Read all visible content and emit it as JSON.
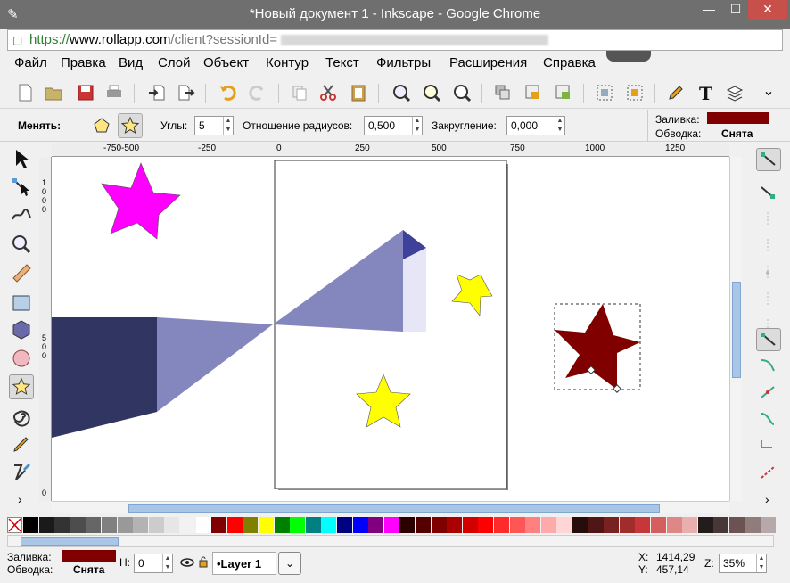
{
  "window": {
    "title": "*Новый документ 1 - Inkscape - Google Chrome",
    "controls": {
      "minimize": "—",
      "maximize": "☐",
      "close": "✕"
    }
  },
  "address": {
    "https": "https://",
    "host": "www.rollapp.com",
    "path": "/client?sessionId="
  },
  "menu": [
    "Файл",
    "Правка",
    "Вид",
    "Слой",
    "Объект",
    "Контур",
    "Текст",
    "Фильтры",
    "Расширения",
    "Справка"
  ],
  "toolbar": {
    "buttons": [
      "new-document",
      "open",
      "save",
      "print",
      "import",
      "export",
      "undo",
      "redo",
      "duplicate",
      "cut",
      "paste",
      "zoom-selection",
      "zoom-drawing",
      "zoom-page",
      "group",
      "lock",
      "unlock",
      "align",
      "node-editor",
      "fill-stroke",
      "text",
      "layers",
      "more"
    ],
    "more_label": "⌄"
  },
  "controls": {
    "change_label": "Менять:",
    "corners_label": "Углы:",
    "corners_value": "5",
    "ratio_label": "Отношение радиусов:",
    "ratio_value": "0,500",
    "rounding_label": "Закругление:",
    "rounding_value": "0,000"
  },
  "style_indicator": {
    "fill_label": "Заливка:",
    "fill_color": "#800000",
    "stroke_label": "Обводка:",
    "stroke_value": "Снята"
  },
  "rulers": {
    "top": [
      "-750",
      "-500",
      "-250",
      "0",
      "250",
      "500",
      "750",
      "1000",
      "1250"
    ],
    "left_a": [
      "1",
      "0",
      "0",
      "0"
    ],
    "left_b": [
      "5",
      "0",
      "0"
    ],
    "left_c": [
      "0"
    ]
  },
  "palette": [
    "#000000",
    "#1a1a1a",
    "#333333",
    "#4d4d4d",
    "#666666",
    "#808080",
    "#999999",
    "#b3b3b3",
    "#cccccc",
    "#e6e6e6",
    "#f2f2f2",
    "#ffffff",
    "#800000",
    "#ff0000",
    "#808000",
    "#ffff00",
    "#008000",
    "#00ff00",
    "#008080",
    "#00ffff",
    "#000080",
    "#0000ff",
    "#800080",
    "#ff00ff",
    "#2b0000",
    "#550000",
    "#800000",
    "#aa0000",
    "#d40000",
    "#ff0000",
    "#ff2a2a",
    "#ff5555",
    "#ff8080",
    "#ffaaaa",
    "#ffd5d5",
    "#280b0b",
    "#501616",
    "#782121",
    "#a02c2c",
    "#c83737",
    "#d35f5f",
    "#de8787",
    "#e9afaf",
    "#241c1c",
    "#483737",
    "#6c5353",
    "#917c7c",
    "#b7a9a9"
  ],
  "status": {
    "fill_label": "Заливка:",
    "fill_color": "#800000",
    "stroke_label": "Обводка:",
    "stroke_value": "Снята",
    "h_label": "Н:",
    "h_value": "0",
    "layer_name": "•Layer 1",
    "x_label": "X:",
    "x_value": "1414,29",
    "y_label": "Y:",
    "y_value": "457,14",
    "zoom_label": "Z:",
    "zoom_value": "35%"
  }
}
